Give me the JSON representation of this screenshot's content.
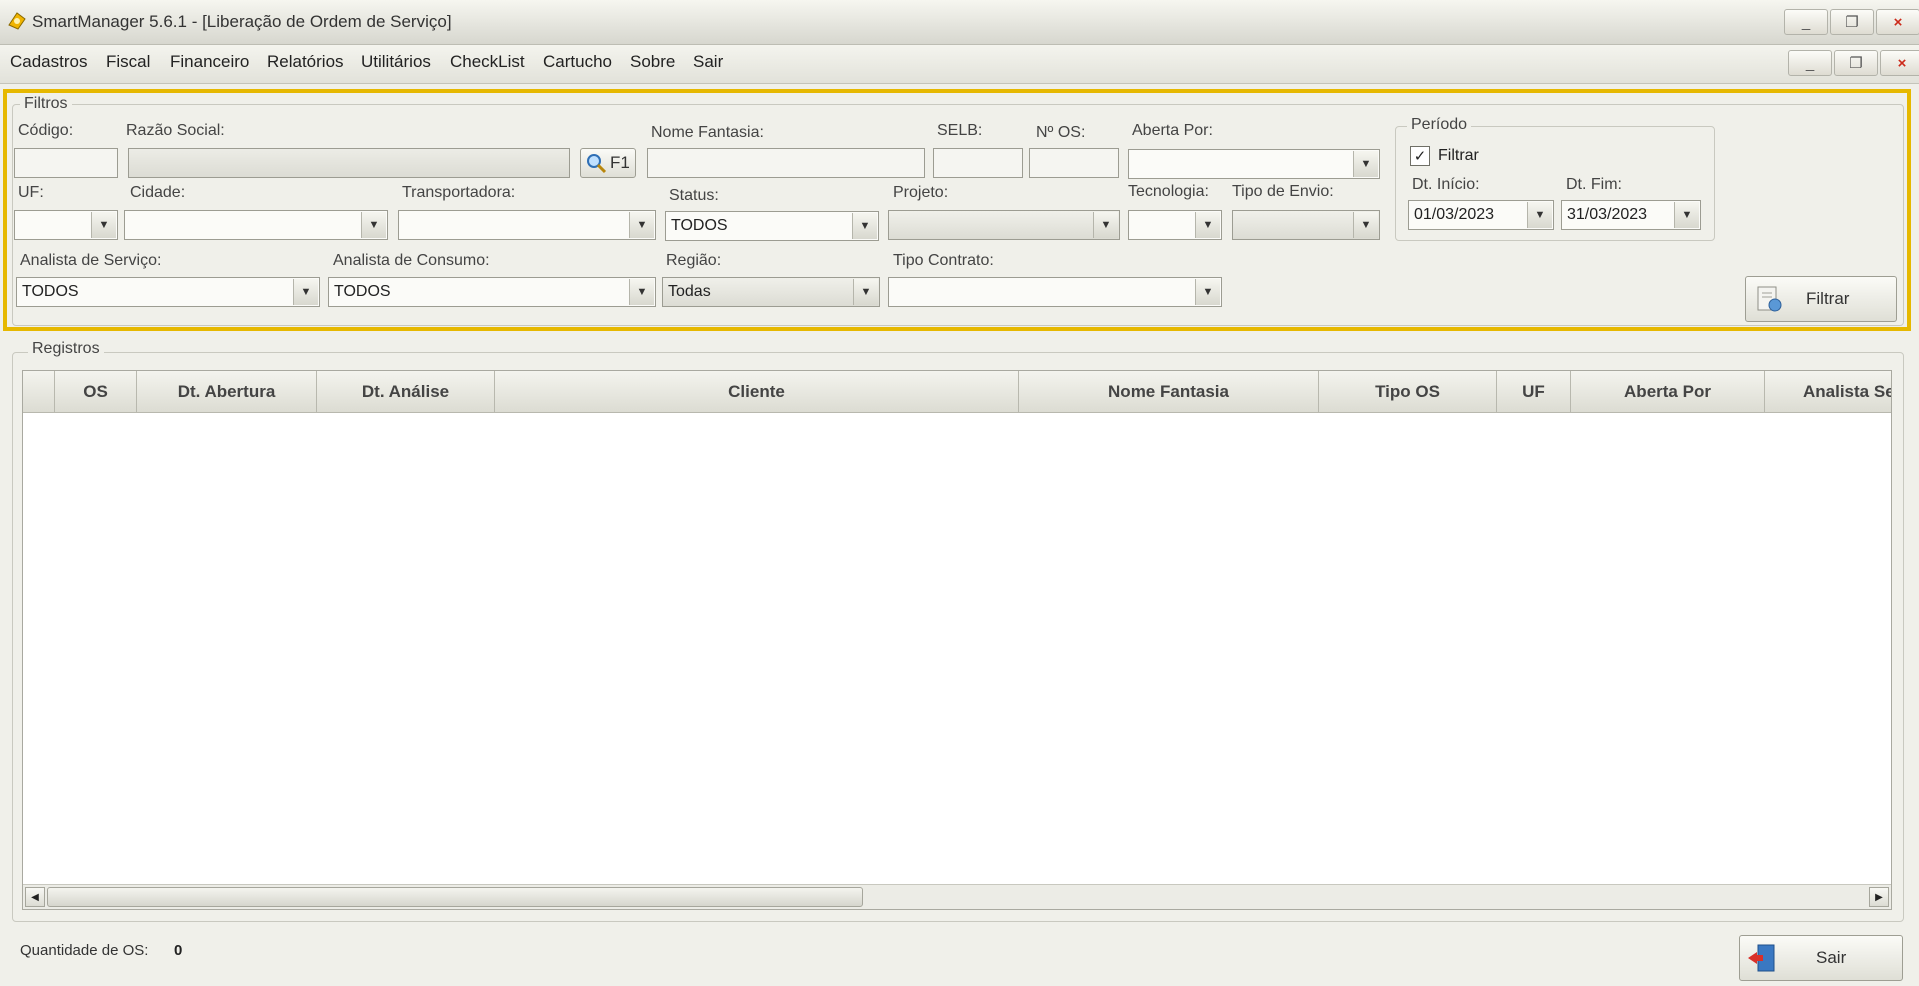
{
  "window": {
    "title": "SmartManager 5.6.1 - [Liberação de Ordem de Serviço]",
    "minimize_glyph": "_",
    "restore_glyph": "❐",
    "close_glyph": "×"
  },
  "menu": [
    "Cadastros",
    "Fiscal",
    "Financeiro",
    "Relatórios",
    "Utilitários",
    "CheckList",
    "Cartucho",
    "Sobre",
    "Sair"
  ],
  "filtros": {
    "legend": "Filtros",
    "codigo_label": "Código:",
    "codigo_value": "",
    "razao_label": "Razão Social:",
    "razao_value": "",
    "search_button": "F1",
    "fantasia_label": "Nome Fantasia:",
    "selb_label": "SELB:",
    "nos_label": "Nº OS:",
    "aberta_label": "Aberta Por:",
    "aberta_value": "",
    "uf_label": "UF:",
    "cidade_label": "Cidade:",
    "transportadora_label": "Transportadora:",
    "status_label": "Status:",
    "status_value": "TODOS",
    "projeto_label": "Projeto:",
    "tecnologia_label": "Tecnologia:",
    "envio_label": "Tipo de Envio:",
    "analista_servico_label": "Analista de Serviço:",
    "analista_servico_value": "TODOS",
    "analista_consumo_label": "Analista de Consumo:",
    "analista_consumo_value": "TODOS",
    "regiao_label": "Região:",
    "regiao_value": "Todas",
    "contrato_label": "Tipo Contrato:",
    "contrato_value": "",
    "filtrar_button": "Filtrar"
  },
  "periodo": {
    "legend": "Período",
    "checkbox_label": "Filtrar",
    "checked": true,
    "inicio_label": "Dt. Início:",
    "inicio_value": "01/03/2023",
    "fim_label": "Dt. Fim:",
    "fim_value": "31/03/2023"
  },
  "registros": {
    "legend": "Registros",
    "columns": [
      "OS",
      "Dt. Abertura",
      "Dt. Análise",
      "Cliente",
      "Nome Fantasia",
      "Tipo OS",
      "UF",
      "Aberta Por",
      "Analista Se"
    ]
  },
  "footer": {
    "qtd_label": "Quantidade de OS:",
    "qtd_value": "0",
    "sair_button": "Sair"
  },
  "colors": {
    "highlight": "#e6b800",
    "accent_red": "#cc2a1a"
  }
}
